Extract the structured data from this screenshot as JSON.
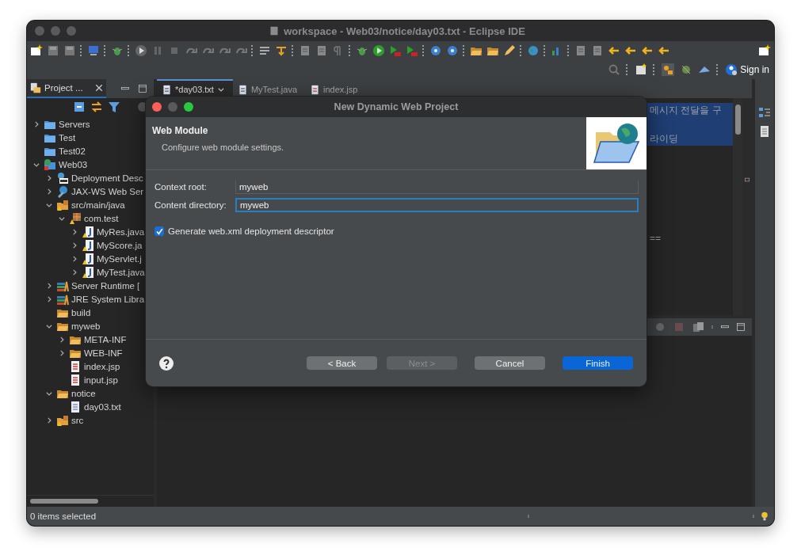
{
  "window": {
    "title": "workspace - Web03/notice/day03.txt - Eclipse IDE"
  },
  "toolbar": {
    "sign_in": "Sign in"
  },
  "project_explorer": {
    "tab": "Project ...",
    "tree": [
      {
        "label": "Servers",
        "kind": "project",
        "expanded": false
      },
      {
        "label": "Test",
        "kind": "project"
      },
      {
        "label": "Test02",
        "kind": "project"
      },
      {
        "label": "Web03",
        "kind": "web",
        "expanded": true,
        "children": [
          {
            "label": "Deployment Desc",
            "kind": "descriptor",
            "expanded": false
          },
          {
            "label": "JAX-WS Web Ser",
            "kind": "webservice",
            "expanded": false
          },
          {
            "label": "src/main/java",
            "kind": "source",
            "expanded": true,
            "children": [
              {
                "label": "com.test",
                "kind": "package",
                "expanded": true,
                "children": [
                  {
                    "label": "MyRes.java",
                    "kind": "java",
                    "expanded": false
                  },
                  {
                    "label": "MyScore.ja",
                    "kind": "java",
                    "expanded": false
                  },
                  {
                    "label": "MyServlet.j",
                    "kind": "java",
                    "expanded": false
                  },
                  {
                    "label": "MyTest.java",
                    "kind": "java",
                    "expanded": false
                  }
                ]
              }
            ]
          },
          {
            "label": "Server Runtime [",
            "kind": "library",
            "expanded": false
          },
          {
            "label": "JRE System Libra",
            "kind": "library",
            "expanded": false
          },
          {
            "label": "build",
            "kind": "folder"
          },
          {
            "label": "myweb",
            "kind": "folder",
            "expanded": true,
            "children": [
              {
                "label": "META-INF",
                "kind": "folder",
                "expanded": false
              },
              {
                "label": "WEB-INF",
                "kind": "folder",
                "expanded": false
              },
              {
                "label": "index.jsp",
                "kind": "jsp"
              },
              {
                "label": "input.jsp",
                "kind": "jsp"
              }
            ]
          },
          {
            "label": "notice",
            "kind": "folder",
            "expanded": true,
            "children": [
              {
                "label": "day03.txt",
                "kind": "text"
              }
            ]
          },
          {
            "label": "src",
            "kind": "source",
            "expanded": false
          }
        ]
      }
    ]
  },
  "editor": {
    "tabs": [
      {
        "label": "*day03.txt",
        "selected": true
      },
      {
        "label": "MyTest.java",
        "selected": false
      },
      {
        "label": "index.jsp",
        "selected": false
      }
    ],
    "lines": [
      {
        "text": "메시지 전달을 구",
        "highlighted": true
      },
      {
        "highlighted": true
      },
      {
        "text": "라이딩",
        "highlighted": true
      },
      {
        "highlighted": false
      },
      {
        "highlighted": false
      },
      {
        "highlighted": false
      },
      {
        "highlighted": false
      },
      {
        "highlighted": false
      },
      {
        "highlighted": false
      },
      {
        "text": "==",
        "highlighted": false
      }
    ]
  },
  "dialog": {
    "title": "New Dynamic Web Project",
    "heading": "Web Module",
    "description": "Configure web module settings.",
    "fields": [
      {
        "label": "Context root:",
        "value": "myweb",
        "focused": false
      },
      {
        "label": "Content directory:",
        "value": "myweb",
        "focused": true
      }
    ],
    "checkbox": {
      "label": "Generate web.xml deployment descriptor",
      "checked": true
    },
    "buttons": [
      {
        "label": "< Back",
        "kind": "normal",
        "disabled": false
      },
      {
        "label": "Next >",
        "kind": "normal",
        "disabled": true
      },
      {
        "label": "Cancel",
        "kind": "normal",
        "disabled": false
      },
      {
        "label": "Finish",
        "kind": "primary",
        "disabled": false
      }
    ]
  },
  "status_bar": {
    "text": "0 items selected"
  }
}
